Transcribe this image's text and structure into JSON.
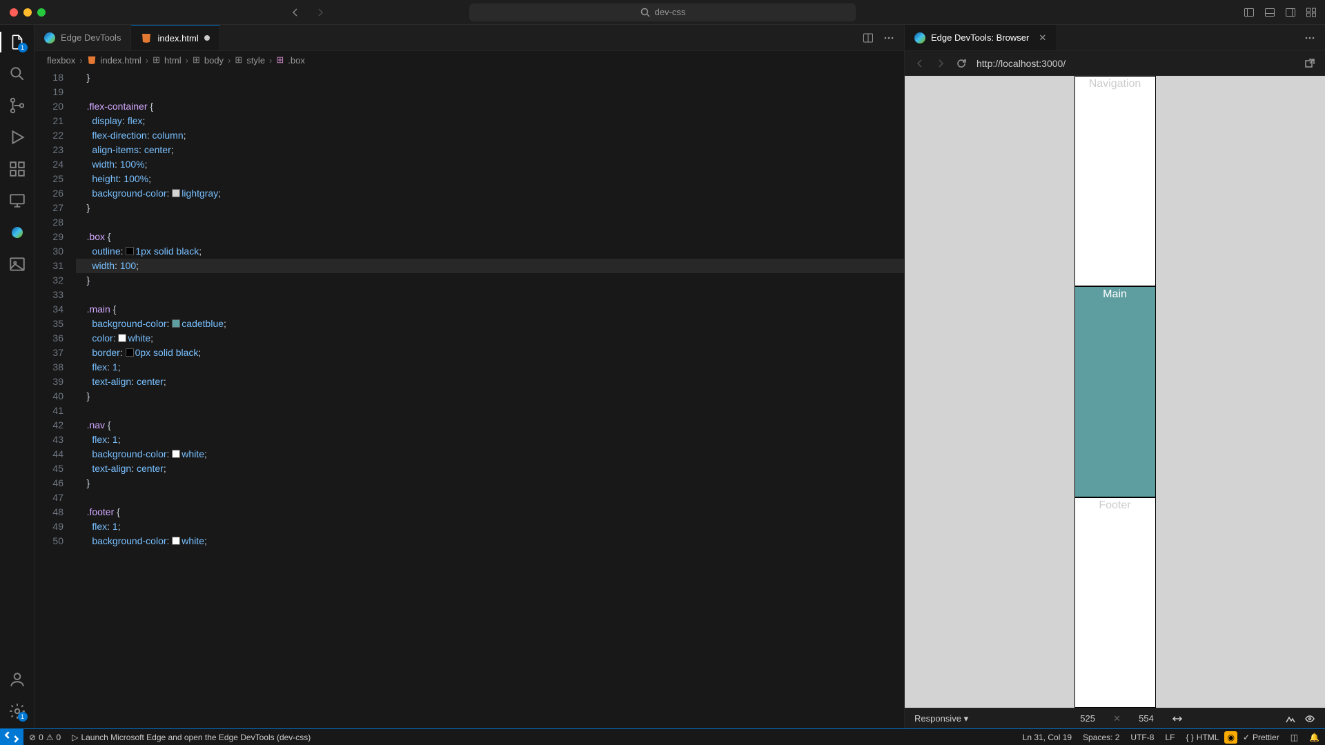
{
  "title": "dev-css",
  "tabs": [
    {
      "label": "Edge DevTools"
    },
    {
      "label": "index.html"
    }
  ],
  "breadcrumb": [
    "flexbox",
    "index.html",
    "html",
    "body",
    "style",
    ".box"
  ],
  "panel": {
    "tab": "Edge DevTools: Browser",
    "url": "http://localhost:3000/"
  },
  "preview": {
    "nav": "Navigation",
    "main": "Main",
    "footer": "Footer"
  },
  "device": {
    "mode": "Responsive",
    "w": "525",
    "h": "554"
  },
  "status": {
    "errors": "0",
    "warnings": "0",
    "launch": "Launch Microsoft Edge and open the Edge DevTools (dev-css)",
    "pos": "Ln 31, Col 19",
    "spaces": "Spaces: 2",
    "enc": "UTF-8",
    "eol": "LF",
    "lang": "HTML",
    "prettier": "Prettier"
  },
  "gutter_start": 18,
  "code": [
    {
      "t": "    }"
    },
    {
      "t": ""
    },
    {
      "t": "    .flex-container {",
      "sel": ".flex-container"
    },
    {
      "t": "      display: flex;",
      "prop": "display",
      "val": "flex"
    },
    {
      "t": "      flex-direction: column;",
      "prop": "flex-direction",
      "val": "column"
    },
    {
      "t": "      align-items: center;",
      "prop": "align-items",
      "val": "center"
    },
    {
      "t": "      width: 100%;",
      "prop": "width",
      "val": "100%"
    },
    {
      "t": "      height: 100%;",
      "prop": "height",
      "val": "100%"
    },
    {
      "t": "      background-color: lightgray;",
      "prop": "background-color",
      "val": "lightgray",
      "sw": "#d3d3d3"
    },
    {
      "t": "    }"
    },
    {
      "t": ""
    },
    {
      "t": "    .box {",
      "sel": ".box"
    },
    {
      "t": "      outline: 1px solid black;",
      "prop": "outline",
      "val": "1px solid black",
      "sw": "#000"
    },
    {
      "t": "      width: 100;",
      "prop": "width",
      "val": "100",
      "cur": true
    },
    {
      "t": "    }"
    },
    {
      "t": ""
    },
    {
      "t": "    .main {",
      "sel": ".main"
    },
    {
      "t": "      background-color: cadetblue;",
      "prop": "background-color",
      "val": "cadetblue",
      "sw": "#5f9ea0"
    },
    {
      "t": "      color: white;",
      "prop": "color",
      "val": "white",
      "sw": "#fff"
    },
    {
      "t": "      border: 0px solid black;",
      "prop": "border",
      "val": "0px solid black",
      "sw": "#000"
    },
    {
      "t": "      flex: 1;",
      "prop": "flex",
      "val": "1"
    },
    {
      "t": "      text-align: center;",
      "prop": "text-align",
      "val": "center"
    },
    {
      "t": "    }"
    },
    {
      "t": ""
    },
    {
      "t": "    .nav {",
      "sel": ".nav"
    },
    {
      "t": "      flex: 1;",
      "prop": "flex",
      "val": "1"
    },
    {
      "t": "      background-color: white;",
      "prop": "background-color",
      "val": "white",
      "sw": "#fff"
    },
    {
      "t": "      text-align: center;",
      "prop": "text-align",
      "val": "center"
    },
    {
      "t": "    }"
    },
    {
      "t": ""
    },
    {
      "t": "    .footer {",
      "sel": ".footer"
    },
    {
      "t": "      flex: 1;",
      "prop": "flex",
      "val": "1"
    },
    {
      "t": "      background-color: white;",
      "prop": "background-color",
      "val": "white",
      "sw": "#fff"
    }
  ],
  "activity_badge": "1"
}
